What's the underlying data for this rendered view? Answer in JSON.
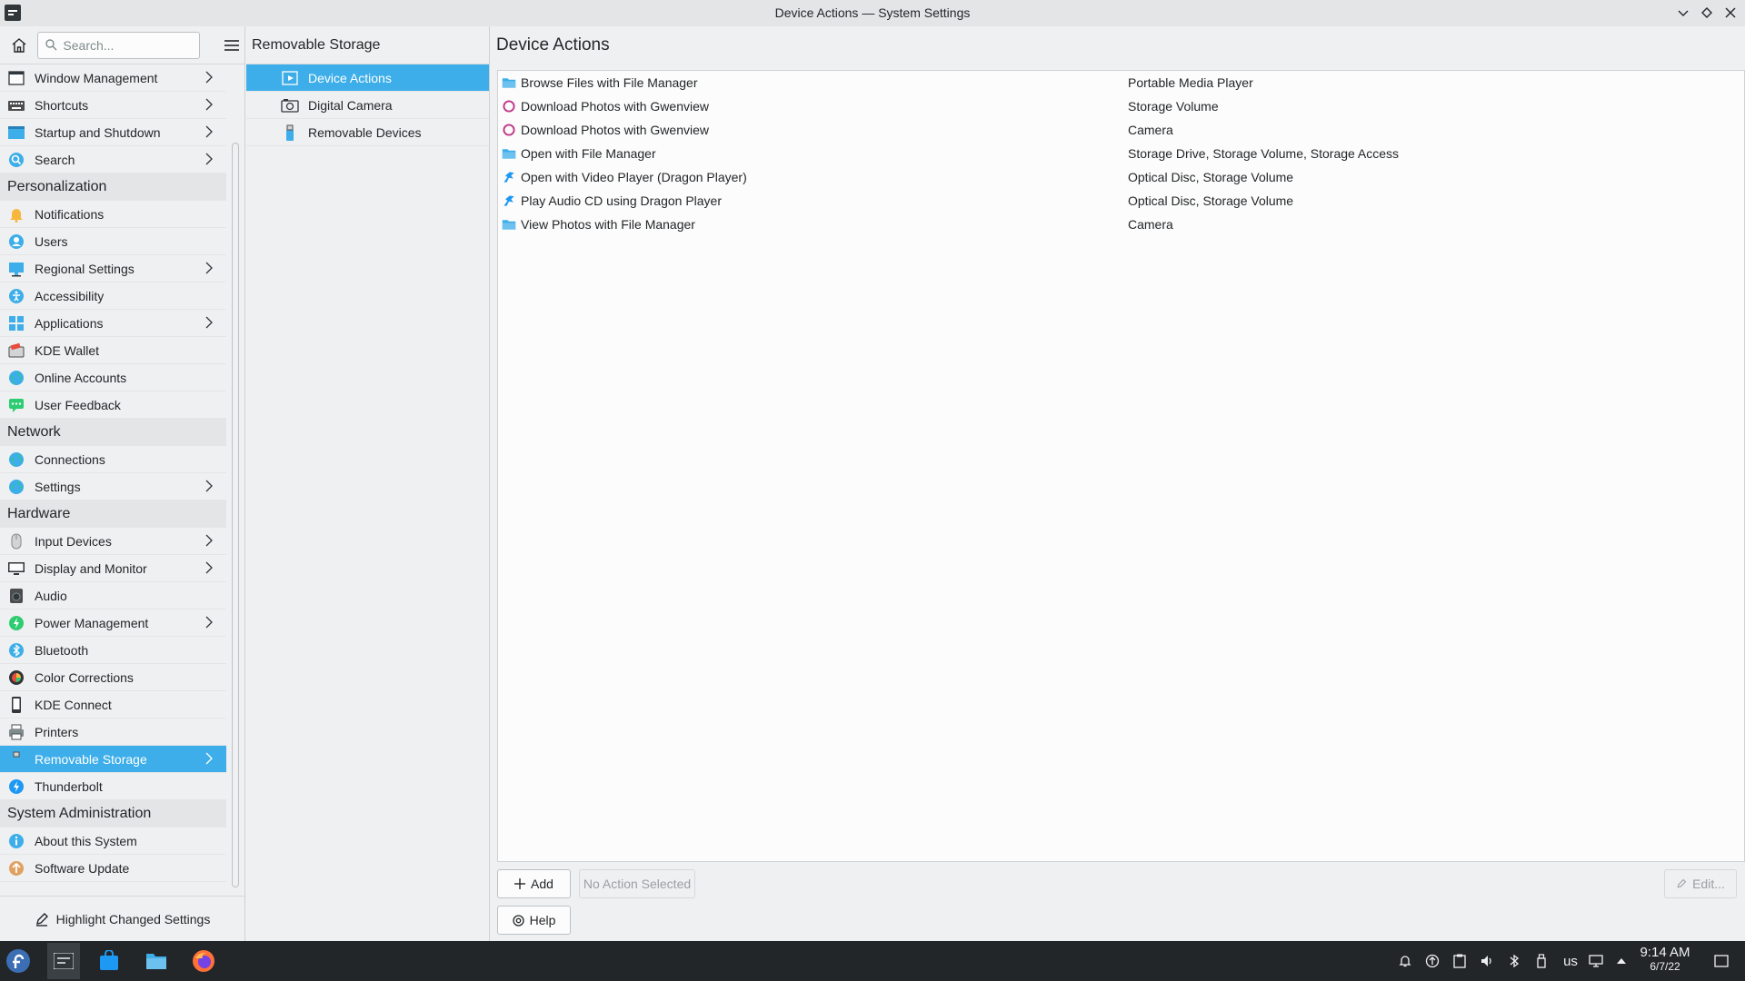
{
  "window": {
    "title": "Device Actions — System Settings"
  },
  "sidebar": {
    "search_placeholder": "Search...",
    "items": [
      {
        "label": "Window Management",
        "icon": "window-management-icon",
        "chevron": true
      },
      {
        "label": "Shortcuts",
        "icon": "keyboard-icon",
        "chevron": true
      },
      {
        "label": "Startup and Shutdown",
        "icon": "startup-icon",
        "chevron": true
      },
      {
        "label": "Search",
        "icon": "search-icon",
        "chevron": true
      }
    ],
    "categories": [
      {
        "title": "Personalization",
        "items": [
          {
            "label": "Notifications",
            "icon": "bell-icon",
            "chevron": false
          },
          {
            "label": "Users",
            "icon": "users-icon",
            "chevron": false
          },
          {
            "label": "Regional Settings",
            "icon": "regional-icon",
            "chevron": true
          },
          {
            "label": "Accessibility",
            "icon": "accessibility-icon",
            "chevron": false
          },
          {
            "label": "Applications",
            "icon": "applications-icon",
            "chevron": true
          },
          {
            "label": "KDE Wallet",
            "icon": "wallet-icon",
            "chevron": false
          },
          {
            "label": "Online Accounts",
            "icon": "globe-icon",
            "chevron": false
          },
          {
            "label": "User Feedback",
            "icon": "feedback-icon",
            "chevron": false
          }
        ]
      },
      {
        "title": "Network",
        "items": [
          {
            "label": "Connections",
            "icon": "globe-icon",
            "chevron": false
          },
          {
            "label": "Settings",
            "icon": "network-settings-icon",
            "chevron": true
          }
        ]
      },
      {
        "title": "Hardware",
        "items": [
          {
            "label": "Input Devices",
            "icon": "mouse-icon",
            "chevron": true
          },
          {
            "label": "Display and Monitor",
            "icon": "monitor-icon",
            "chevron": true
          },
          {
            "label": "Audio",
            "icon": "speaker-icon",
            "chevron": false
          },
          {
            "label": "Power Management",
            "icon": "power-icon",
            "chevron": true
          },
          {
            "label": "Bluetooth",
            "icon": "bluetooth-icon",
            "chevron": false
          },
          {
            "label": "Color Corrections",
            "icon": "color-icon",
            "chevron": false
          },
          {
            "label": "KDE Connect",
            "icon": "phone-icon",
            "chevron": false
          },
          {
            "label": "Printers",
            "icon": "printer-icon",
            "chevron": false
          },
          {
            "label": "Removable Storage",
            "icon": "usb-icon",
            "chevron": true,
            "selected": true
          },
          {
            "label": "Thunderbolt",
            "icon": "thunderbolt-icon",
            "chevron": false
          }
        ]
      },
      {
        "title": "System Administration",
        "items": [
          {
            "label": "About this System",
            "icon": "info-icon",
            "chevron": false
          },
          {
            "label": "Software Update",
            "icon": "update-icon",
            "chevron": false
          }
        ]
      }
    ],
    "footer_label": "Highlight Changed Settings"
  },
  "middle": {
    "title": "Removable Storage",
    "items": [
      {
        "label": "Device Actions",
        "icon": "device-actions-icon",
        "selected": true
      },
      {
        "label": "Digital Camera",
        "icon": "camera-icon",
        "selected": false
      },
      {
        "label": "Removable Devices",
        "icon": "usb-icon",
        "selected": false
      }
    ]
  },
  "main": {
    "title": "Device Actions",
    "actions": [
      {
        "name": "Browse Files with File Manager",
        "types": "Portable Media Player",
        "icon": "folder-icon"
      },
      {
        "name": "Download Photos with Gwenview",
        "types": "Storage Volume",
        "icon": "gwenview-icon"
      },
      {
        "name": "Download Photos with Gwenview",
        "types": "Camera",
        "icon": "gwenview-icon"
      },
      {
        "name": "Open with File Manager",
        "types": "Storage Drive, Storage Volume, Storage Access",
        "icon": "folder-icon"
      },
      {
        "name": "Open with Video Player (Dragon Player)",
        "types": "Optical Disc, Storage Volume",
        "icon": "dragon-player-icon"
      },
      {
        "name": "Play Audio CD using Dragon Player",
        "types": "Optical Disc, Storage Volume",
        "icon": "dragon-player-icon"
      },
      {
        "name": "View Photos with File Manager",
        "types": "Camera",
        "icon": "folder-icon"
      }
    ],
    "add_label": "Add",
    "no_action_label": "No Action Selected",
    "edit_label": "Edit...",
    "help_label": "Help"
  },
  "taskbar": {
    "keyboard_layout": "us",
    "time": "9:14 AM",
    "date": "6/7/22"
  },
  "colors": {
    "accent": "#3daee9",
    "taskbar": "#232629"
  }
}
